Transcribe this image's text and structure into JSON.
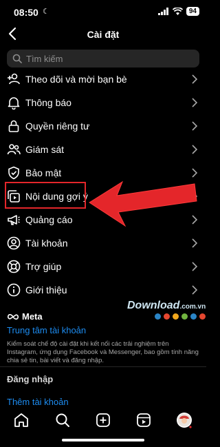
{
  "status_bar": {
    "time": "08:50",
    "battery": "94"
  },
  "header": {
    "title": "Cài đặt"
  },
  "search": {
    "placeholder": "Tìm kiếm"
  },
  "menu": [
    {
      "label": "Theo dõi và mời bạn bè",
      "icon": "add-person-icon"
    },
    {
      "label": "Thông báo",
      "icon": "bell-icon"
    },
    {
      "label": "Quyền riêng tư",
      "icon": "lock-icon"
    },
    {
      "label": "Giám sát",
      "icon": "supervision-icon"
    },
    {
      "label": "Bảo mật",
      "icon": "shield-icon"
    },
    {
      "label": "Nội dung gợi ý",
      "icon": "suggested-content-icon"
    },
    {
      "label": "Quảng cáo",
      "icon": "megaphone-icon"
    },
    {
      "label": "Tài khoản",
      "icon": "account-icon"
    },
    {
      "label": "Trợ giúp",
      "icon": "lifebuoy-icon"
    },
    {
      "label": "Giới thiệu",
      "icon": "info-icon"
    }
  ],
  "meta_section": {
    "logo_text": "Meta",
    "accounts_center": "Trung tâm tài khoản",
    "description": "Kiểm soát chế độ cài đặt khi kết nối các trải nghiệm trên Instagram, ứng dụng Facebook và Messenger, bao gồm tính năng chia sẻ tin, bài viết và đăng nhập."
  },
  "login": {
    "section_label": "Đăng nhập",
    "add_account": "Thêm tài khoản"
  },
  "watermark": {
    "text": "Download",
    "domain": ".com.vn"
  },
  "colors": {
    "highlight": "#e4262a",
    "link": "#1d8cf0"
  }
}
